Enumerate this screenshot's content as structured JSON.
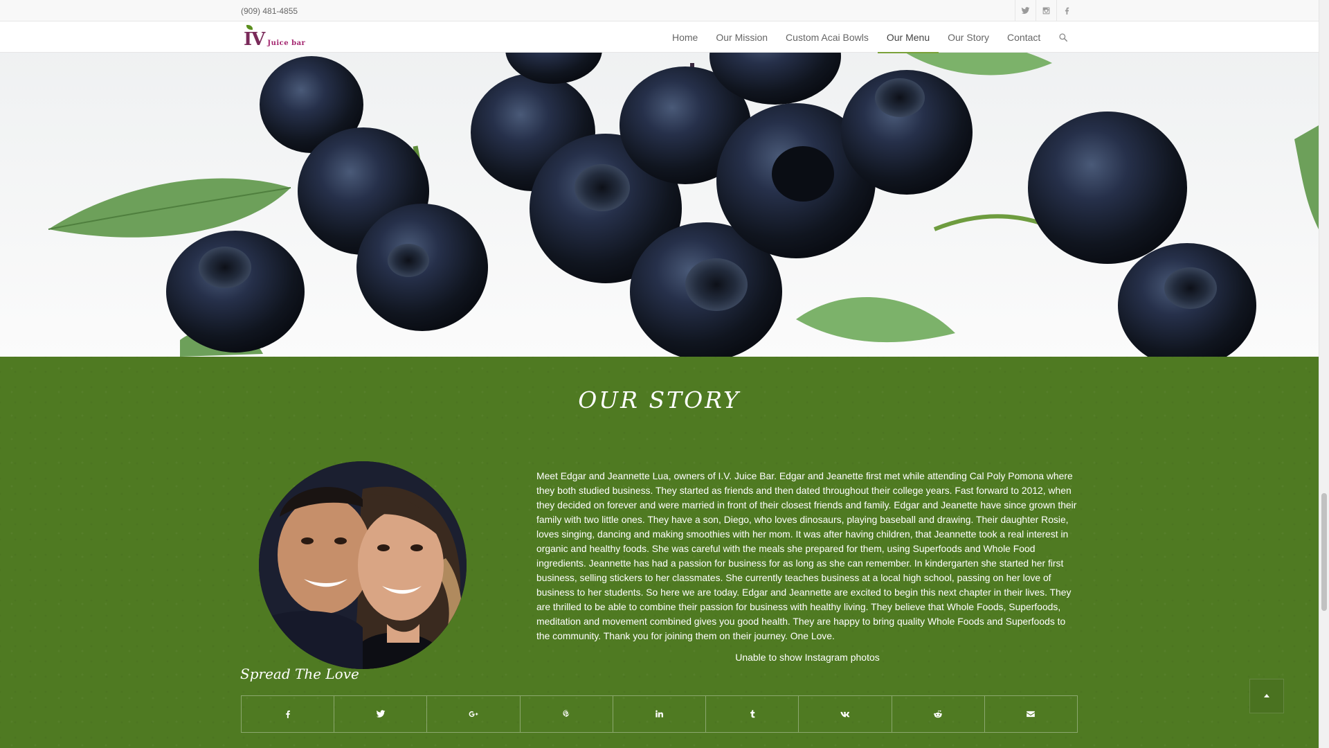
{
  "topbar": {
    "phone": "(909) 481-4855",
    "social_icons": [
      "twitter-icon",
      "instagram-icon",
      "facebook-icon"
    ]
  },
  "logo": {
    "mark": "IV",
    "text": "Juice bar"
  },
  "nav": {
    "items": [
      {
        "label": "Home"
      },
      {
        "label": "Our Mission"
      },
      {
        "label": "Custom Acai Bowls"
      },
      {
        "label": "Our Menu",
        "active": true
      },
      {
        "label": "Our Story"
      },
      {
        "label": "Contact"
      }
    ],
    "search_icon": "search-icon"
  },
  "story": {
    "title": "OUR STORY",
    "body": "Meet Edgar and Jeannette Lua, owners of I.V. Juice Bar. Edgar and Jeanette first met while attending Cal Poly Pomona where they both studied business. They started as friends and then dated throughout their college years. Fast forward to 2012, when they decided on forever and were married in front of their closest friends and family. Edgar and Jeanette have since grown their family with two little ones. They have a son, Diego, who loves dinosaurs, playing baseball and drawing. Their daughter Rosie, loves singing, dancing and making smoothies with her mom. It was after having children, that Jeannette took a real interest in organic and healthy foods. She was careful with the meals she prepared for them, using Superfoods and Whole Food ingredients. Jeannette has had a passion for business for as long as she can remember. In kindergarten she started her first business, selling stickers to her classmates. She currently teaches business at a local high school, passing on her love of business to her students. So here we are today. Edgar and Jeannette are excited to begin this next chapter in their lives. They are thrilled to be able to combine their passion for business with healthy living. They believe that Whole Foods, Superfoods, meditation and movement combined gives you good health. They are happy to bring quality Whole Foods and Superfoods to the community. Thank you for joining them on their journey. One Love.",
    "instagram_notice": "Unable to show Instagram photos",
    "share_heading": "Spread The Love",
    "share_buttons": [
      "facebook-icon",
      "twitter-icon",
      "google-plus-icon",
      "pinterest-icon",
      "linkedin-icon",
      "tumblr-icon",
      "vk-icon",
      "reddit-icon",
      "mail-icon"
    ]
  },
  "colors": {
    "section_green": "#4f7a22",
    "nav_active_underline": "#7ba23a",
    "logo_purple": "#7a2a5a"
  }
}
